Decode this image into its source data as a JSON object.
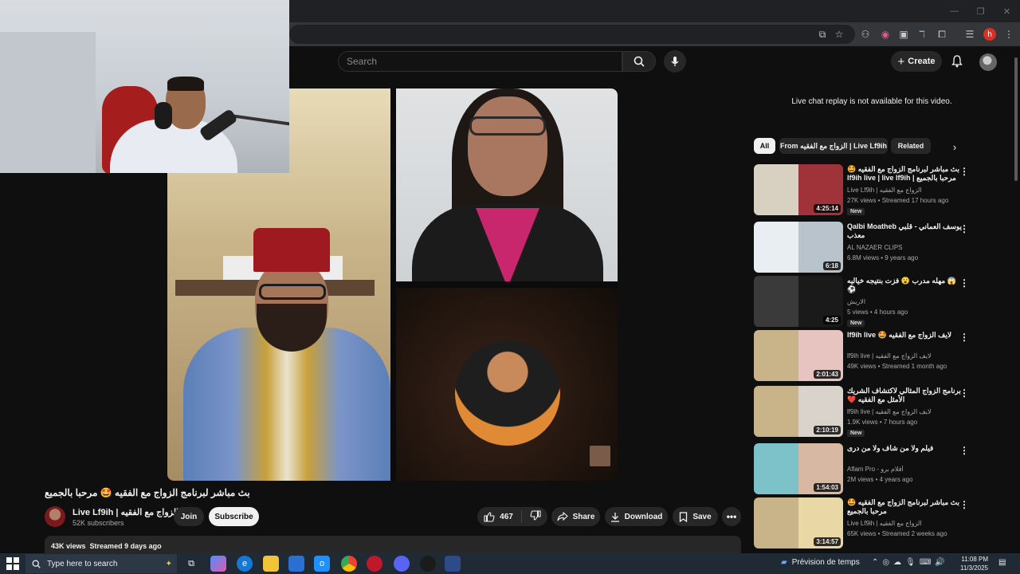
{
  "browser": {
    "window_controls": [
      "—",
      "❐",
      "✕"
    ],
    "profile_initial": "h"
  },
  "youtube": {
    "search_placeholder": "Search",
    "create_label": "Create"
  },
  "video": {
    "title": "بث مباشر لبرنامج الزواج مع الفقيه 🤩 مرحبا بالجميع",
    "channel_name": "Live Lf9ih | الزواج مع الفقيه",
    "subscribers": "52K subscribers",
    "join_label": "Join",
    "subscribe_label": "Subscribe",
    "likes": "467",
    "share_label": "Share",
    "download_label": "Download",
    "save_label": "Save",
    "views": "43K views",
    "streamed": "Streamed 9 days ago"
  },
  "chat": {
    "note": "Live chat replay is not available for this video."
  },
  "chips": {
    "all": "All",
    "from": "From الزواج مع الفقيه | Live Lf9ih",
    "related": "Related"
  },
  "recommendations": [
    {
      "title": "بث مباشر لبرنامج الزواج مع الفقيه 🤩 مرحبا بالجميع | lf9ih live | live lf9ih",
      "channel": "Live Lf9ih | الزواج مع الفقيه",
      "meta": "27K views • Streamed 17 hours ago",
      "duration": "4:25:14",
      "badge": "New",
      "colors": [
        "#d8d0c0",
        "#a0323a"
      ]
    },
    {
      "title": "Qalbi Moatheb يوسف العماني - قلبي معذب",
      "channel": "AL NAZAER CLIPS",
      "meta": "6.8M views • 9 years ago",
      "duration": "6:18",
      "badge": "",
      "colors": [
        "#e9eef2",
        "#b9c3cc"
      ]
    },
    {
      "title": "😱 مهله مدرب 😮 فزت بنتيجه خياليه ⚽",
      "channel": "الاريش",
      "meta": "5 views • 4 hours ago",
      "duration": "4:25",
      "badge": "New",
      "colors": [
        "#3a3a3a",
        "#1a1a1a"
      ]
    },
    {
      "title": "لايف الزواج مع الفقيه 🤩 lf9ih live",
      "channel": "lf9ih live | لايف الزواج مع الفقيه",
      "meta": "49K views • Streamed 1 month ago",
      "duration": "2:01:43",
      "badge": "",
      "colors": [
        "#c9b489",
        "#e7c4c0"
      ]
    },
    {
      "title": "برنامج الزواج المثالي لاكتشاف الشريك الأمثل مع الفقيه ❤️",
      "channel": "lf9ih live | لايف الزواج مع الفقيه",
      "meta": "1.9K views • 7 hours ago",
      "duration": "2:10:19",
      "badge": "New",
      "colors": [
        "#c9b489",
        "#d9d3cc"
      ]
    },
    {
      "title": "فيلم ولا من شاف ولا من درى",
      "channel": "Aflam Pro - أفلام برو",
      "meta": "2M views • 4 years ago",
      "duration": "1:54:03",
      "badge": "",
      "colors": [
        "#7cc2c8",
        "#d7b9a3"
      ]
    },
    {
      "title": "بث مباشر لبرنامج الزواج مع الفقيه 🤩 مرحبا بالجميع",
      "channel": "Live Lf9ih | الزواج مع الفقيه",
      "meta": "65K views • Streamed 2 weeks ago",
      "duration": "3:14:57",
      "badge": "",
      "colors": [
        "#c9b489",
        "#e9d7a5"
      ]
    }
  ],
  "taskbar": {
    "search_placeholder": "Type here to search",
    "weather": "Prévision de temps",
    "time": "11:08 PM",
    "date": "11/3/2025"
  }
}
